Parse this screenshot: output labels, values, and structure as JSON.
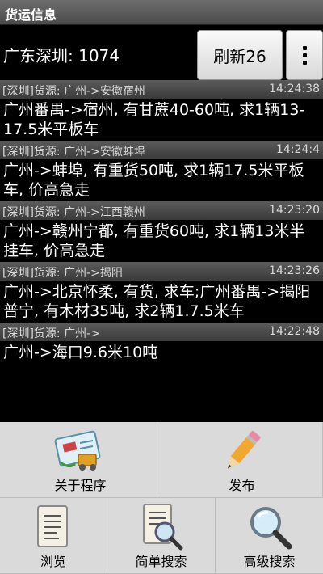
{
  "app": {
    "title": "货运信息"
  },
  "header": {
    "location": "广东深圳: 1074",
    "refresh_label": "刷新26"
  },
  "items": [
    {
      "source": "[深圳]货源: 广州->安徽宿州",
      "time": "14:24:38",
      "text": "广州番禺->宿州, 有甘蔗40-60吨, 求1辆13-17.5米平板车"
    },
    {
      "source": "[深圳]货源: 广州->安徽蚌埠",
      "time": "14:24:4",
      "text": "广州->蚌埠, 有重货50吨, 求1辆17.5米平板车, 价高急走"
    },
    {
      "source": "[深圳]货源: 广州->江西赣州",
      "time": "14:23:20",
      "text": "广州->赣州宁都, 有重货60吨, 求1辆13米半挂车, 价高急走"
    },
    {
      "source": "[深圳]货源: 广州->揭阳",
      "time": "14:23:26",
      "text": "广州->北京怀柔, 有货, 求车;广州番禺->揭阳普宁, 有木材35吨, 求2辆1.7.5米车"
    },
    {
      "source": "[深圳]货源: 广州->",
      "time": "14:22:48",
      "text": "广州->海口9.6米10吨"
    }
  ],
  "menu": [
    {
      "label": "关于程序",
      "icon": "about-icon"
    },
    {
      "label": "发布",
      "icon": "pencil-icon"
    },
    {
      "label": "浏览",
      "icon": "document-icon"
    },
    {
      "label": "简单搜索",
      "icon": "document-search-icon"
    },
    {
      "label": "高级搜索",
      "icon": "magnifier-icon"
    }
  ]
}
